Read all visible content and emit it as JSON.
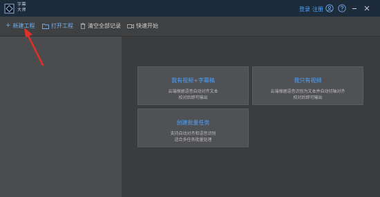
{
  "app": {
    "name_line1": "字幕",
    "name_line2": "大师"
  },
  "titlebar": {
    "login": "登录",
    "register": "注册"
  },
  "toolbar": {
    "new_project": "新建工程",
    "open_project": "打开工程",
    "clear_all": "清空全部记录",
    "quick_start": "快速开始"
  },
  "cards": {
    "video_subtitle": {
      "title": "我有视频+字幕稿",
      "desc1": "云端根据语音自动对齐文本",
      "desc2": "校对后即可输出"
    },
    "video_only": {
      "title": "我只有视频",
      "desc1": "云端根据语音识别为文本并自动切轴对齐",
      "desc2": "校对后即可输出"
    },
    "batch": {
      "title": "创建批量任务",
      "desc1": "支持自动对齐和语音识别",
      "desc2": "适合多任务批量处理"
    }
  },
  "colors": {
    "accent": "#4aa3ff",
    "titlebar": "#1d2b3b",
    "annotation_arrow": "#e0302a"
  }
}
